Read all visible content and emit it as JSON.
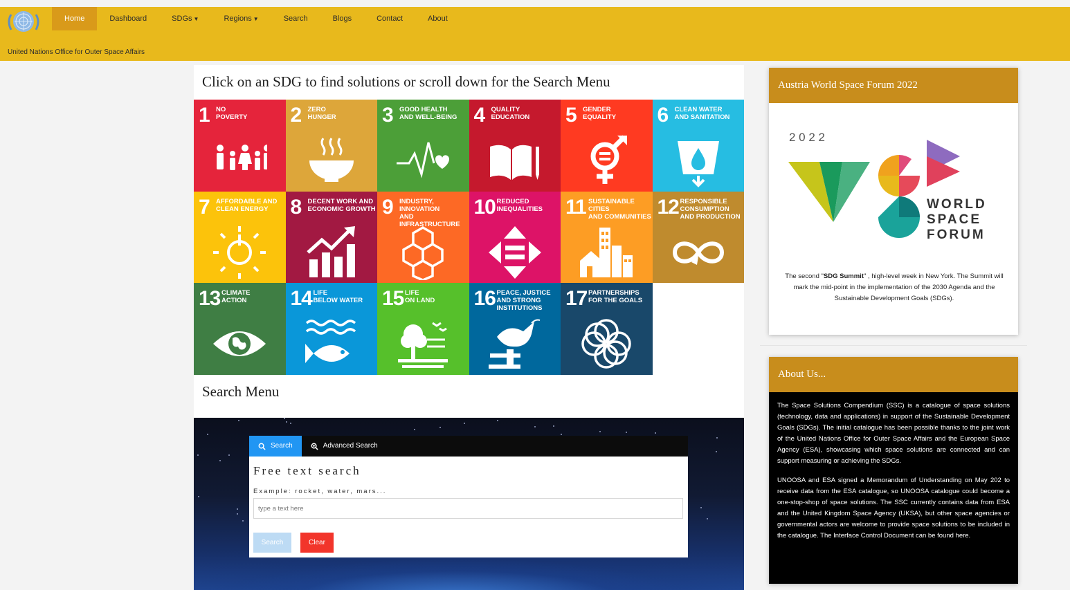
{
  "header": {
    "org_name": "United Nations Office for Outer Space Affairs",
    "nav": [
      {
        "label": "Home",
        "active": true
      },
      {
        "label": "Dashboard"
      },
      {
        "label": "SDGs",
        "dropdown": true
      },
      {
        "label": "Regions",
        "dropdown": true
      },
      {
        "label": "Search"
      },
      {
        "label": "Blogs"
      },
      {
        "label": "Contact"
      },
      {
        "label": "About"
      }
    ],
    "colors": {
      "bar": "#e8b91c",
      "active": "#d99a1a"
    }
  },
  "main": {
    "title": "Click on an SDG to find solutions or scroll down for the Search Menu",
    "sdgs": [
      {
        "num": "1",
        "label": "NO\nPOVERTY",
        "color": "#e5243b",
        "icon": "family-icon"
      },
      {
        "num": "2",
        "label": "ZERO\nHUNGER",
        "color": "#dda63a",
        "icon": "bowl-icon"
      },
      {
        "num": "3",
        "label": "GOOD HEALTH\nAND WELL-BEING",
        "color": "#4c9f38",
        "icon": "heartbeat-icon"
      },
      {
        "num": "4",
        "label": "QUALITY\nEDUCATION",
        "color": "#c5192d",
        "icon": "book-icon"
      },
      {
        "num": "5",
        "label": "GENDER\nEQUALITY",
        "color": "#ff3a21",
        "icon": "gender-icon"
      },
      {
        "num": "6",
        "label": "CLEAN WATER\nAND SANITATION",
        "color": "#26bde2",
        "icon": "water-icon"
      },
      {
        "num": "7",
        "label": "AFFORDABLE AND\nCLEAN ENERGY",
        "color": "#fcc30b",
        "icon": "power-sun-icon"
      },
      {
        "num": "8",
        "label": "DECENT WORK AND\nECONOMIC GROWTH",
        "color": "#a21942",
        "icon": "growth-chart-icon"
      },
      {
        "num": "9",
        "label": "INDUSTRY, INNOVATION\nAND INFRASTRUCTURE",
        "color": "#fd6925",
        "icon": "cubes-icon"
      },
      {
        "num": "10",
        "label": "REDUCED\nINEQUALITIES",
        "color": "#dd1367",
        "icon": "equality-arrows-icon"
      },
      {
        "num": "11",
        "label": "SUSTAINABLE CITIES\nAND COMMUNITIES",
        "color": "#fd9d24",
        "icon": "city-icon"
      },
      {
        "num": "12",
        "label": "RESPONSIBLE\nCONSUMPTION\nAND PRODUCTION",
        "color": "#bf8b2e",
        "icon": "infinity-icon"
      },
      {
        "num": "13",
        "label": "CLIMATE\nACTION",
        "color": "#3f7e44",
        "icon": "eye-globe-icon"
      },
      {
        "num": "14",
        "label": "LIFE\nBELOW WATER",
        "color": "#0a97d9",
        "icon": "fish-icon"
      },
      {
        "num": "15",
        "label": "LIFE\nON LAND",
        "color": "#56c02b",
        "icon": "tree-icon"
      },
      {
        "num": "16",
        "label": "PEACE, JUSTICE\nAND STRONG\nINSTITUTIONS",
        "color": "#00689d",
        "icon": "dove-gavel-icon"
      },
      {
        "num": "17",
        "label": "PARTNERSHIPS\nFOR THE GOALS",
        "color": "#19486a",
        "icon": "rings-icon"
      }
    ],
    "search_menu_title": "Search Menu"
  },
  "search": {
    "tab_search": "Search",
    "tab_advanced": "Advanced Search",
    "free_title": "Free text search",
    "example": "Example: rocket, water, mars...",
    "placeholder": "type a text here",
    "value": "",
    "btn_search": "Search",
    "btn_clear": "Clear"
  },
  "sidebar": {
    "forum": {
      "title": "Austria World Space Forum 2022",
      "logo_year": "2 0 2 2",
      "logo_words": [
        "WORLD",
        "SPACE",
        "FORUM"
      ],
      "text_before": "The second \"",
      "text_bold": "SDG Summit",
      "text_after": "\" , high-level week in New York. The Summit will  mark the mid-point in the implementation of the 2030 Agenda and the Sustainable Development Goals (SDGs)."
    },
    "about": {
      "title": "About Us...",
      "p1": "The Space Solutions Compendium (SSC) is a catalogue of space solutions (technology, data and applications) in support of the Sustainable Development Goals (SDGs). The initial catalogue has been possible thanks to the joint work of the United Nations Office for Outer Space Affairs and the European Space Agency (ESA), showcasing which space solutions are connected and can support measuring or achieving the SDGs.",
      "p2": "UNOOSA and ESA signed a Memorandum of Understanding on May 202 to receive data from the ESA catalogue, so UNOOSA catalogue could become a one-stop-shop of space solutions. The SSC currently contains data from ESA and the United Kingdom Space Agency (UKSA), but other space agencies or governmental actors are welcome to provide space solutions to be included in the catalogue. The Interface Control Document can be found here."
    }
  }
}
